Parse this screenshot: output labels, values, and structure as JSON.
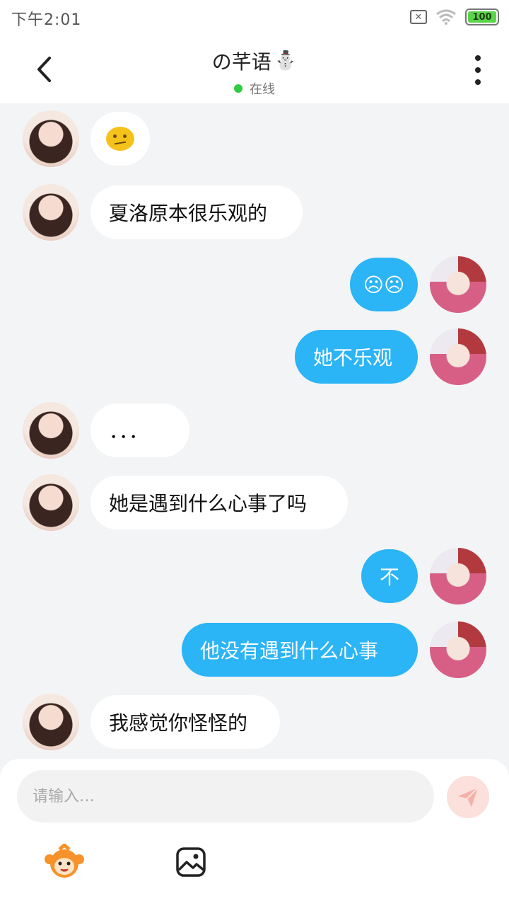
{
  "status_bar": {
    "time": "下午2:01",
    "battery": "100",
    "icons": [
      "sim-card-icon",
      "wifi-icon",
      "battery-icon"
    ]
  },
  "header": {
    "title": "の芊语",
    "title_emoji": "⛄",
    "status": "在线",
    "status_color": "#2ecc40"
  },
  "colors": {
    "outgoing_bubble": "#2bb4f6",
    "incoming_bubble": "#ffffff",
    "background": "#f3f4f6"
  },
  "messages": [
    {
      "side": "in",
      "type": "emoji",
      "emoji": "confused-face-icon",
      "text": ""
    },
    {
      "side": "in",
      "type": "text",
      "text": "夏洛原本很乐观的"
    },
    {
      "side": "out",
      "type": "text",
      "text": "☹☹"
    },
    {
      "side": "out",
      "type": "text",
      "text": "她不乐观"
    },
    {
      "side": "in",
      "type": "text",
      "text": "．．．"
    },
    {
      "side": "in",
      "type": "text",
      "text": "她是遇到什么心事了吗"
    },
    {
      "side": "out",
      "type": "text",
      "text": "不"
    },
    {
      "side": "out",
      "type": "text",
      "text": "他没有遇到什么心事"
    },
    {
      "side": "in",
      "type": "text",
      "text": "我感觉你怪怪的"
    }
  ],
  "composer": {
    "placeholder": "请输入…",
    "value": "",
    "send_icon": "paper-plane-icon",
    "toolbar_icons": [
      "mascot-face-icon",
      "image-icon"
    ]
  }
}
